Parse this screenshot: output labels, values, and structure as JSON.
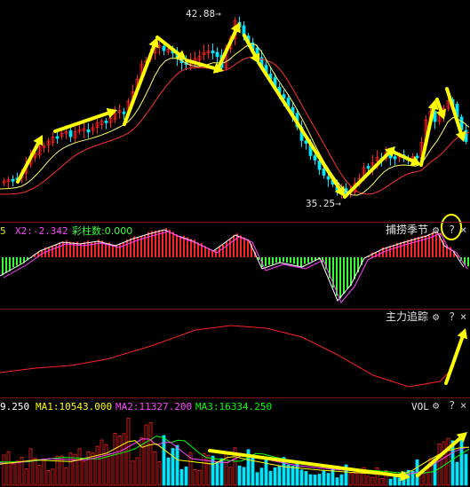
{
  "price_panel": {
    "high_label": "42.88",
    "low_label": "35.25"
  },
  "indicator1": {
    "params": [
      {
        "text": "5",
        "color": "#e8e800"
      },
      {
        "text": "X2:-2.342",
        "color": "#ff44ff"
      },
      {
        "text": "彩柱数:0.000",
        "color": "#33ff33"
      }
    ],
    "title": "捕捞季节",
    "controls": {
      "settings": "⚙",
      "help": "?",
      "close": "×"
    }
  },
  "indicator2": {
    "title": "主力追踪",
    "controls": {
      "settings": "⚙",
      "help": "?",
      "close": "×"
    }
  },
  "volume": {
    "params": [
      {
        "text": "9.250",
        "color": "#ffffff"
      },
      {
        "text": "MA1:10543.000",
        "color": "#ffff00"
      },
      {
        "text": "MA2:11327.200",
        "color": "#ff44ff"
      },
      {
        "text": "MA3:16334.250",
        "color": "#00ff00"
      }
    ],
    "title": "VOL",
    "controls": {
      "settings": "⚙",
      "help": "?",
      "close": "×"
    }
  },
  "colors": {
    "up": "#ff2020",
    "down": "#00e5ff",
    "ma_fast": "#ffff66",
    "ma_slow": "#ff3030",
    "annotation": "#ffff00",
    "dif_bar_up": "#ff2020",
    "dif_bar_down": "#33ff33"
  }
}
